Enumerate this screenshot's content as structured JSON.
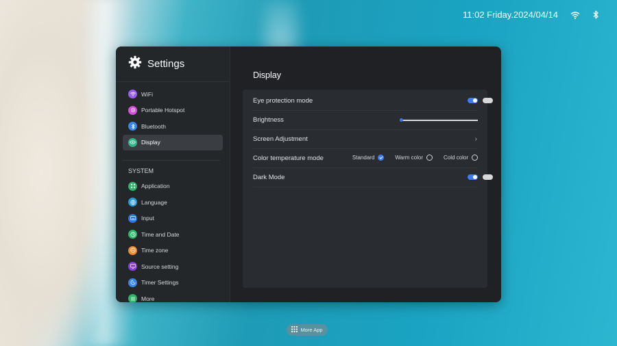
{
  "status_bar": {
    "clock": "11:02 Friday.2024/04/14",
    "icons": [
      "wifi-icon",
      "bluetooth-icon"
    ]
  },
  "sidebar": {
    "title": "Settings",
    "items": [
      {
        "label": "WiFi",
        "icon": "wifi-icon",
        "color": "#9b5cf0"
      },
      {
        "label": "Portable Hotspot",
        "icon": "hotspot-icon",
        "color": "#d64fe0"
      },
      {
        "label": "Bluetooth",
        "icon": "bluetooth-icon",
        "color": "#3a86e8"
      },
      {
        "label": "Display",
        "icon": "eye-icon",
        "color": "#2fb98a",
        "active": true
      }
    ],
    "section_label": "SYSTEM",
    "system_items": [
      {
        "label": "Application",
        "icon": "apps-icon",
        "color": "#2fb56a"
      },
      {
        "label": "Language",
        "icon": "globe-icon",
        "color": "#2a9bd6"
      },
      {
        "label": "Input",
        "icon": "keyboard-icon",
        "color": "#2a74e8"
      },
      {
        "label": "Time and Date",
        "icon": "clock-icon",
        "color": "#2fb56a"
      },
      {
        "label": "Time zone",
        "icon": "timezone-icon",
        "color": "#f08a2a"
      },
      {
        "label": "Source setting",
        "icon": "source-icon",
        "color": "#8b3fe0"
      },
      {
        "label": "Timer Settings",
        "icon": "timer-icon",
        "color": "#3a86e8"
      },
      {
        "label": "More",
        "icon": "more-icon",
        "color": "#2fb56a"
      }
    ]
  },
  "main": {
    "title": "Display",
    "rows": {
      "eye_protection": {
        "label": "Eye protection mode",
        "enabled": true
      },
      "brightness": {
        "label": "Brightness",
        "value": 0
      },
      "screen_adjustment": {
        "label": "Screen Adjustment"
      },
      "color_temperature": {
        "label": "Color temperature mode",
        "options": [
          "Standard",
          "Warm color",
          "Cold color"
        ],
        "selected": "Standard"
      },
      "dark_mode": {
        "label": "Dark Mode",
        "enabled": true
      }
    }
  },
  "dock": {
    "more_app_label": "More App"
  },
  "colors": {
    "accent": "#3f7bf0"
  }
}
